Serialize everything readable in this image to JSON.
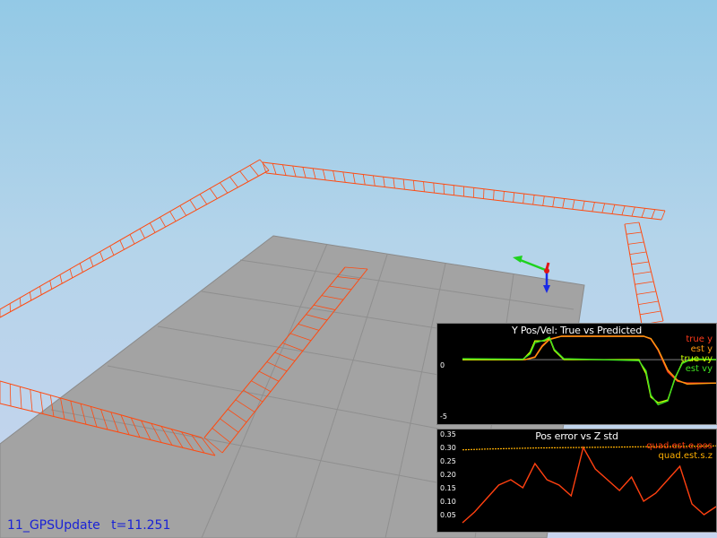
{
  "status": {
    "scenario": "11_GPSUpdate",
    "time": "t=11.251"
  },
  "colors": {
    "trajectory": "#ff4a10",
    "floor": "#a3a3a3",
    "true_y": "#ff3a1a",
    "est_y": "#ff9a10",
    "true_vy": "#c8ff00",
    "est_vy": "#40e020",
    "pos_err": "#ff4010",
    "std_z": "#ffb000"
  },
  "chart_data": [
    {
      "type": "line",
      "title": "Y Pos/Vel: True vs Predicted",
      "xlabel": "",
      "ylabel": "",
      "yticks": [
        "0",
        "-5"
      ],
      "ylim": [
        -6.5,
        2.5
      ],
      "series": [
        {
          "name": "true y",
          "x": [
            0,
            2.6,
            3.0,
            3.3,
            3.6,
            4.1,
            4.5,
            7.5,
            7.8,
            8.1,
            8.5,
            8.9,
            9.3,
            10.5
          ],
          "y": [
            0,
            0,
            0.3,
            1.5,
            2.2,
            2.5,
            2.5,
            2.5,
            2.2,
            1.0,
            -1.3,
            -2.3,
            -2.5,
            -2.5
          ]
        },
        {
          "name": "est y",
          "x": [
            0,
            2.6,
            3.0,
            3.3,
            3.6,
            4.1,
            4.5,
            7.5,
            7.8,
            8.1,
            8.5,
            8.9,
            9.3,
            10.5
          ],
          "y": [
            0,
            0,
            0.25,
            1.4,
            2.15,
            2.5,
            2.5,
            2.5,
            2.25,
            1.1,
            -1.1,
            -2.2,
            -2.6,
            -2.5
          ]
        },
        {
          "name": "true vy",
          "x": [
            0,
            2.5,
            2.8,
            3.0,
            3.4,
            3.6,
            3.8,
            4.2,
            7.3,
            7.6,
            7.8,
            8.1,
            8.5,
            8.8,
            9.1,
            9.5,
            10.5
          ],
          "y": [
            0,
            0,
            0.8,
            2.0,
            2.0,
            2.3,
            1.0,
            0,
            0,
            -1.5,
            -4.0,
            -4.6,
            -4.3,
            -2.0,
            -0.3,
            0,
            0
          ]
        },
        {
          "name": "est vy",
          "x": [
            0,
            2.5,
            2.8,
            3.0,
            3.4,
            3.6,
            3.8,
            4.2,
            7.3,
            7.6,
            7.8,
            8.1,
            8.5,
            8.8,
            9.1,
            9.5,
            10.5
          ],
          "y": [
            0.1,
            0.05,
            0.6,
            1.8,
            2.1,
            2.4,
            1.1,
            0.1,
            -0.1,
            -1.2,
            -3.8,
            -4.8,
            -4.4,
            -1.9,
            -0.4,
            0.1,
            0.0
          ]
        }
      ]
    },
    {
      "type": "line",
      "title": "Pos error vs Z std",
      "xlabel": "",
      "ylabel": "",
      "yticks": [
        "0.35",
        "0.30",
        "0.25",
        "0.20",
        "0.15",
        "0.10",
        "0.05"
      ],
      "ylim": [
        0,
        0.35
      ],
      "series": [
        {
          "name": "quad.est.e.pos",
          "x": [
            0,
            0.5,
            1.0,
            1.5,
            2.0,
            2.5,
            3.0,
            3.5,
            4.0,
            4.5,
            5.0,
            5.5,
            6.0,
            6.5,
            7.0,
            7.5,
            8.0,
            8.5,
            9.0,
            9.5,
            10.0,
            10.5
          ],
          "y": [
            0.02,
            0.06,
            0.11,
            0.16,
            0.18,
            0.15,
            0.24,
            0.18,
            0.16,
            0.12,
            0.3,
            0.22,
            0.18,
            0.14,
            0.19,
            0.1,
            0.13,
            0.18,
            0.23,
            0.09,
            0.05,
            0.08
          ]
        },
        {
          "name": "quad.est.s.z",
          "x": [
            0,
            1,
            2,
            3,
            4,
            5,
            6,
            7,
            8,
            9,
            10,
            10.5
          ],
          "y": [
            0.291,
            0.294,
            0.296,
            0.298,
            0.299,
            0.3,
            0.301,
            0.302,
            0.303,
            0.304,
            0.305,
            0.306
          ]
        }
      ]
    }
  ]
}
